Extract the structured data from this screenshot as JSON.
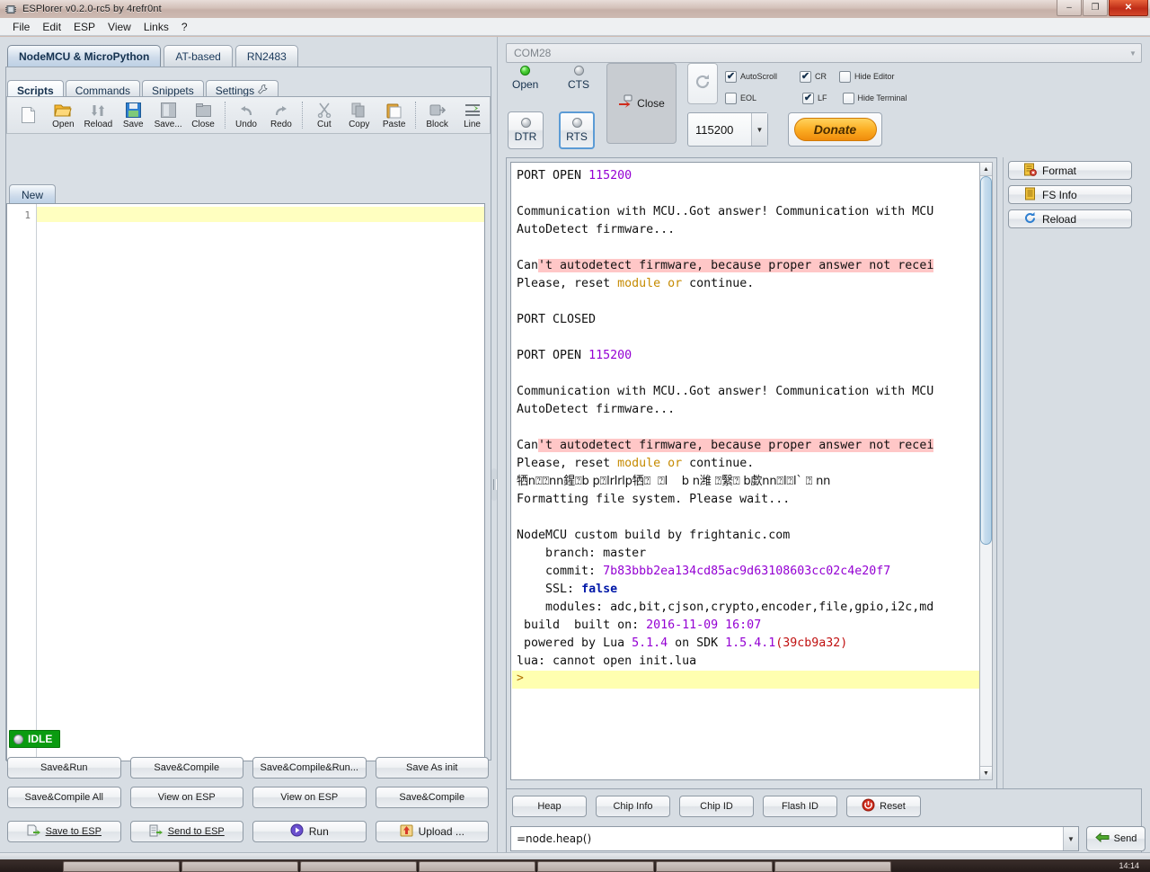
{
  "window": {
    "title": "ESPlorer v0.2.0-rc5 by 4refr0nt",
    "icon": "chip-icon",
    "controls": {
      "minimize": "–",
      "maximize": "❐",
      "close": "✕"
    }
  },
  "menubar": {
    "items": [
      "File",
      "Edit",
      "ESP",
      "View",
      "Links",
      "?"
    ]
  },
  "board_tabs": [
    {
      "label": "NodeMCU & MicroPython",
      "active": true
    },
    {
      "label": "AT-based",
      "active": false
    },
    {
      "label": "RN2483",
      "active": false
    }
  ],
  "sub_tabs": [
    {
      "label": "Scripts",
      "active": true,
      "icon": ""
    },
    {
      "label": "Commands",
      "active": false,
      "icon": ""
    },
    {
      "label": "Snippets",
      "active": false,
      "icon": ""
    },
    {
      "label": "Settings",
      "active": false,
      "icon": "wrench-icon"
    }
  ],
  "toolbar": [
    {
      "label": "",
      "icon": "new-file-icon"
    },
    {
      "label": "Open",
      "icon": "open-folder-icon"
    },
    {
      "label": "Reload",
      "icon": "reload-icon"
    },
    {
      "label": "Save",
      "icon": "save-floppy-icon"
    },
    {
      "label": "Save...",
      "icon": "save-as-icon"
    },
    {
      "label": "Close",
      "icon": "close-file-icon"
    },
    {
      "label": "Undo",
      "icon": "undo-icon"
    },
    {
      "label": "Redo",
      "icon": "redo-icon"
    },
    {
      "label": "Cut",
      "icon": "scissors-icon"
    },
    {
      "label": "Copy",
      "icon": "copy-icon"
    },
    {
      "label": "Paste",
      "icon": "paste-icon"
    },
    {
      "label": "Block",
      "icon": "block-icon"
    },
    {
      "label": "Line",
      "icon": "line-icon"
    }
  ],
  "editor": {
    "tab_label": "New",
    "line_number": "1",
    "content": ""
  },
  "status": {
    "label": "IDLE",
    "led": "idle-led",
    "color": "#0a9b10"
  },
  "action_buttons": [
    [
      {
        "label": "Save&Run",
        "icon": ""
      },
      {
        "label": "Save&Compile",
        "icon": ""
      },
      {
        "label": "Save&Compile&Run...",
        "icon": ""
      },
      {
        "label": "Save As init",
        "icon": ""
      }
    ],
    [
      {
        "label": "Save&Compile All",
        "icon": ""
      },
      {
        "label": "View on ESP",
        "icon": ""
      },
      {
        "label": "View on ESP",
        "icon": ""
      },
      {
        "label": "Save&Compile",
        "icon": ""
      }
    ],
    [
      {
        "label": "Save to ESP",
        "icon": "save-to-esp-icon",
        "mnemonic": "S"
      },
      {
        "label": "Send to ESP",
        "icon": "send-to-esp-icon",
        "mnemonic": "S"
      },
      {
        "label": "Run",
        "icon": "run-icon",
        "mnemonic": ""
      },
      {
        "label": "Upload ...",
        "icon": "upload-icon",
        "mnemonic": ""
      }
    ]
  ],
  "serial": {
    "port": "COM28",
    "port_arrow": "▼",
    "leds": [
      {
        "name": "Open",
        "state": "on"
      },
      {
        "name": "CTS",
        "state": "off"
      }
    ],
    "toggles": [
      {
        "name": "DTR",
        "selected": false
      },
      {
        "name": "RTS",
        "selected": true
      }
    ],
    "close_button": {
      "label": "Close",
      "icon": "disconnect-icon"
    },
    "refresh_button": {
      "icon": "refresh-icon"
    },
    "checkboxes": [
      {
        "label": "AutoScroll",
        "checked": true
      },
      {
        "label": "EOL",
        "checked": false
      },
      {
        "label": "CR",
        "checked": true
      },
      {
        "label": "LF",
        "checked": true
      },
      {
        "label": "Hide Editor",
        "checked": false
      },
      {
        "label": "Hide Terminal",
        "checked": false
      }
    ],
    "baud": "115200",
    "baud_arrow": "▼",
    "donate": "Donate"
  },
  "file_buttons": [
    {
      "label": "Format",
      "icon": "format-icon"
    },
    {
      "label": "FS Info",
      "icon": "fs-info-icon"
    },
    {
      "label": "Reload",
      "icon": "reload-blue-icon"
    }
  ],
  "terminal": {
    "lines": [
      {
        "segments": [
          {
            "t": "PORT OPEN "
          },
          {
            "t": "115200",
            "c": "num"
          }
        ]
      },
      {
        "segments": []
      },
      {
        "segments": [
          {
            "t": "Communication with MCU..Got answer! Communication with MCU"
          }
        ]
      },
      {
        "segments": [
          {
            "t": "AutoDetect firmware..."
          }
        ]
      },
      {
        "segments": []
      },
      {
        "segments": [
          {
            "t": "Can"
          },
          {
            "t": "'t autodetect firmware, because proper answer not recei",
            "c": "err"
          }
        ]
      },
      {
        "segments": [
          {
            "t": "Please, reset "
          },
          {
            "t": "module",
            "c": "orange"
          },
          {
            "t": " "
          },
          {
            "t": "or",
            "c": "orange"
          },
          {
            "t": " continue."
          }
        ]
      },
      {
        "segments": []
      },
      {
        "segments": [
          {
            "t": "PORT CLOSED"
          }
        ]
      },
      {
        "segments": []
      },
      {
        "segments": [
          {
            "t": "PORT OPEN "
          },
          {
            "t": "115200",
            "c": "num"
          }
        ]
      },
      {
        "segments": []
      },
      {
        "segments": [
          {
            "t": "Communication with MCU..Got answer! Communication with MCU"
          }
        ]
      },
      {
        "segments": [
          {
            "t": "AutoDetect firmware..."
          }
        ]
      },
      {
        "segments": []
      },
      {
        "segments": [
          {
            "t": "Can"
          },
          {
            "t": "'t autodetect firmware, because proper answer not recei",
            "c": "err"
          }
        ]
      },
      {
        "segments": [
          {
            "t": "Please, reset "
          },
          {
            "t": "module",
            "c": "orange"
          },
          {
            "t": " "
          },
          {
            "t": "or",
            "c": "orange"
          },
          {
            "t": " continue."
          }
        ]
      },
      {
        "segments": [
          {
            "t": "牺n⍰⍰nn鍟⍰b p⍰lrlrlp牺⍰  ⍰l    b n潍 ⍰繄⍰ b歔nn⍰l⍰l` ⍰ nn",
            "c": "garble"
          }
        ]
      },
      {
        "segments": [
          {
            "t": "Formatting file system. Please wait..."
          }
        ]
      },
      {
        "segments": []
      },
      {
        "segments": [
          {
            "t": "NodeMCU custom build by frightanic.com"
          }
        ]
      },
      {
        "segments": [
          {
            "t": "    branch: master"
          }
        ]
      },
      {
        "segments": [
          {
            "t": "    commit: "
          },
          {
            "t": "7b83bbb2ea134cd85ac9d63108603cc02c4e20f7",
            "c": "num"
          }
        ]
      },
      {
        "segments": [
          {
            "t": "    SSL: "
          },
          {
            "t": "false",
            "c": "blue"
          }
        ]
      },
      {
        "segments": [
          {
            "t": "    modules: adc,bit,cjson,crypto,encoder,file,gpio,i2c,md"
          }
        ]
      },
      {
        "segments": [
          {
            "t": " build  built on: "
          },
          {
            "t": "2016-11-09 16:07",
            "c": "num"
          }
        ]
      },
      {
        "segments": [
          {
            "t": " powered by Lua "
          },
          {
            "t": "5.1.4",
            "c": "num"
          },
          {
            "t": " on SDK "
          },
          {
            "t": "1.5.4.1",
            "c": "num"
          },
          {
            "t": "(",
            "c": "red"
          },
          {
            "t": "39cb9a32",
            "c": "red"
          },
          {
            "t": ")",
            "c": "red"
          }
        ]
      },
      {
        "segments": [
          {
            "t": "lua: cannot open init.lua"
          }
        ]
      }
    ],
    "prompt": ">",
    "scroll_up": "▲",
    "scroll_down": "▼",
    "scroll_left": "◄",
    "scroll_right": "►"
  },
  "command_bar": {
    "buttons": [
      {
        "label": "Heap",
        "icon": ""
      },
      {
        "label": "Chip Info",
        "icon": ""
      },
      {
        "label": "Chip ID",
        "icon": ""
      },
      {
        "label": "Flash ID",
        "icon": ""
      },
      {
        "label": "Reset",
        "icon": "power-reset-icon"
      }
    ],
    "input_value": "=node.heap()",
    "input_arrow": "▼",
    "send_label": "Send",
    "send_icon": "send-arrow-icon"
  },
  "taskbar": {
    "clock": "14:14"
  }
}
